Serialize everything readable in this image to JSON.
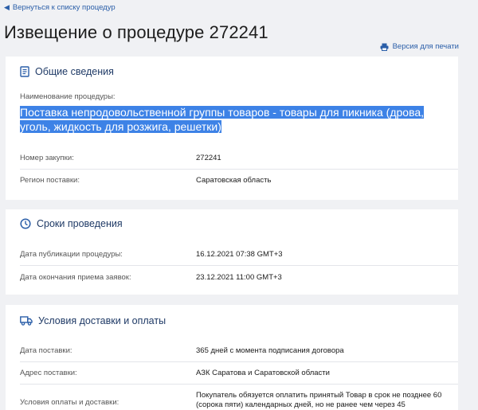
{
  "nav": {
    "back_label": "Вернуться к списку процедур"
  },
  "page": {
    "title": "Извещение о процедуре 272241",
    "print_label": "Версия для печати"
  },
  "general": {
    "heading": "Общие сведения",
    "name_label": "Наименование процедуры:",
    "name_value": "Поставка непродовольственной группы товаров - товары для пикника (дрова, уголь, жидкость для розжига, решетки)",
    "rows": [
      {
        "label": "Номер закупки:",
        "value": "272241"
      },
      {
        "label": "Регион поставки:",
        "value": "Саратовская область"
      }
    ]
  },
  "timing": {
    "heading": "Сроки проведения",
    "rows": [
      {
        "label": "Дата публикации процедуры:",
        "value": "16.12.2021 07:38 GMT+3"
      },
      {
        "label": "Дата окончания приема заявок:",
        "value": "23.12.2021 11:00 GMT+3"
      }
    ]
  },
  "delivery": {
    "heading": "Условия доставки и оплаты",
    "rows": [
      {
        "label": "Дата поставки:",
        "value": "365 дней с момента подписания договора"
      },
      {
        "label": "Адрес поставки:",
        "value": "АЗК Саратова и Саратовской области"
      },
      {
        "label": "Условия оплаты и доставки:",
        "value": "Покупатель обязуется оплатить принятый Товар в срок не позднее 60 (сорока пяти) календарных дней, но не ранее чем через 45"
      }
    ]
  }
}
